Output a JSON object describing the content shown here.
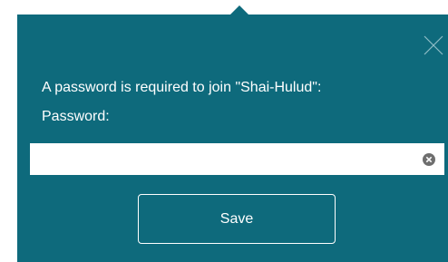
{
  "dialog": {
    "prompt": "A password is required to join \"Shai-Hulud\":",
    "password_label": "Password:",
    "password_value": "",
    "password_placeholder": "",
    "save_label": "Save",
    "close_icon": "close-icon",
    "clear_icon": "clear-input-icon"
  },
  "colors": {
    "panel_background": "#0e6a7c",
    "text": "#ffffff",
    "input_background": "#ffffff",
    "clear_icon": "#6e6e6e"
  }
}
